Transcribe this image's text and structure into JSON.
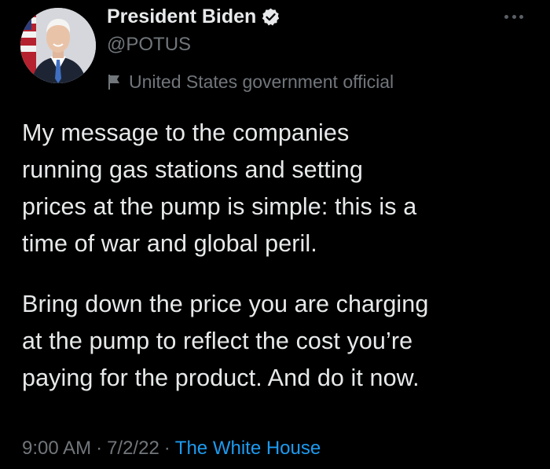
{
  "author": {
    "display_name": "President Biden",
    "handle": "@POTUS",
    "account_label": "United States government official"
  },
  "icons": {
    "verified": "verified-badge-icon",
    "label": "flag-icon",
    "more": "more-options-icon"
  },
  "tweet": {
    "paragraphs": [
      "My message to the companies\nrunning gas stations and setting\nprices at the pump is simple: this is a\ntime of war and global peril.",
      "Bring down the price you are charging\nat the pump to reflect the cost you’re\npaying for the product. And do it now."
    ],
    "time": "9:00 AM",
    "date": "7/2/22",
    "source": "The White House",
    "separator": "·"
  },
  "colors": {
    "background": "#000000",
    "text": "#e7e9ea",
    "secondary": "#71767b",
    "link": "#1d9bf0"
  }
}
